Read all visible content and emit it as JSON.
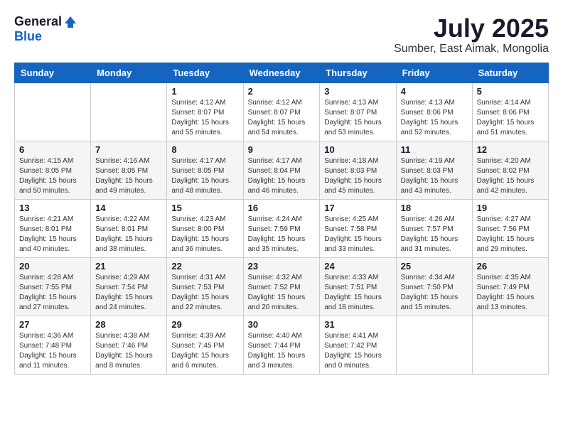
{
  "header": {
    "logo_general": "General",
    "logo_blue": "Blue",
    "month_title": "July 2025",
    "location": "Sumber, East Aimak, Mongolia"
  },
  "weekdays": [
    "Sunday",
    "Monday",
    "Tuesday",
    "Wednesday",
    "Thursday",
    "Friday",
    "Saturday"
  ],
  "weeks": [
    [
      {
        "day": "",
        "sunrise": "",
        "sunset": "",
        "daylight": ""
      },
      {
        "day": "",
        "sunrise": "",
        "sunset": "",
        "daylight": ""
      },
      {
        "day": "1",
        "sunrise": "Sunrise: 4:12 AM",
        "sunset": "Sunset: 8:07 PM",
        "daylight": "Daylight: 15 hours and 55 minutes."
      },
      {
        "day": "2",
        "sunrise": "Sunrise: 4:12 AM",
        "sunset": "Sunset: 8:07 PM",
        "daylight": "Daylight: 15 hours and 54 minutes."
      },
      {
        "day": "3",
        "sunrise": "Sunrise: 4:13 AM",
        "sunset": "Sunset: 8:07 PM",
        "daylight": "Daylight: 15 hours and 53 minutes."
      },
      {
        "day": "4",
        "sunrise": "Sunrise: 4:13 AM",
        "sunset": "Sunset: 8:06 PM",
        "daylight": "Daylight: 15 hours and 52 minutes."
      },
      {
        "day": "5",
        "sunrise": "Sunrise: 4:14 AM",
        "sunset": "Sunset: 8:06 PM",
        "daylight": "Daylight: 15 hours and 51 minutes."
      }
    ],
    [
      {
        "day": "6",
        "sunrise": "Sunrise: 4:15 AM",
        "sunset": "Sunset: 8:05 PM",
        "daylight": "Daylight: 15 hours and 50 minutes."
      },
      {
        "day": "7",
        "sunrise": "Sunrise: 4:16 AM",
        "sunset": "Sunset: 8:05 PM",
        "daylight": "Daylight: 15 hours and 49 minutes."
      },
      {
        "day": "8",
        "sunrise": "Sunrise: 4:17 AM",
        "sunset": "Sunset: 8:05 PM",
        "daylight": "Daylight: 15 hours and 48 minutes."
      },
      {
        "day": "9",
        "sunrise": "Sunrise: 4:17 AM",
        "sunset": "Sunset: 8:04 PM",
        "daylight": "Daylight: 15 hours and 46 minutes."
      },
      {
        "day": "10",
        "sunrise": "Sunrise: 4:18 AM",
        "sunset": "Sunset: 8:03 PM",
        "daylight": "Daylight: 15 hours and 45 minutes."
      },
      {
        "day": "11",
        "sunrise": "Sunrise: 4:19 AM",
        "sunset": "Sunset: 8:03 PM",
        "daylight": "Daylight: 15 hours and 43 minutes."
      },
      {
        "day": "12",
        "sunrise": "Sunrise: 4:20 AM",
        "sunset": "Sunset: 8:02 PM",
        "daylight": "Daylight: 15 hours and 42 minutes."
      }
    ],
    [
      {
        "day": "13",
        "sunrise": "Sunrise: 4:21 AM",
        "sunset": "Sunset: 8:01 PM",
        "daylight": "Daylight: 15 hours and 40 minutes."
      },
      {
        "day": "14",
        "sunrise": "Sunrise: 4:22 AM",
        "sunset": "Sunset: 8:01 PM",
        "daylight": "Daylight: 15 hours and 38 minutes."
      },
      {
        "day": "15",
        "sunrise": "Sunrise: 4:23 AM",
        "sunset": "Sunset: 8:00 PM",
        "daylight": "Daylight: 15 hours and 36 minutes."
      },
      {
        "day": "16",
        "sunrise": "Sunrise: 4:24 AM",
        "sunset": "Sunset: 7:59 PM",
        "daylight": "Daylight: 15 hours and 35 minutes."
      },
      {
        "day": "17",
        "sunrise": "Sunrise: 4:25 AM",
        "sunset": "Sunset: 7:58 PM",
        "daylight": "Daylight: 15 hours and 33 minutes."
      },
      {
        "day": "18",
        "sunrise": "Sunrise: 4:26 AM",
        "sunset": "Sunset: 7:57 PM",
        "daylight": "Daylight: 15 hours and 31 minutes."
      },
      {
        "day": "19",
        "sunrise": "Sunrise: 4:27 AM",
        "sunset": "Sunset: 7:56 PM",
        "daylight": "Daylight: 15 hours and 29 minutes."
      }
    ],
    [
      {
        "day": "20",
        "sunrise": "Sunrise: 4:28 AM",
        "sunset": "Sunset: 7:55 PM",
        "daylight": "Daylight: 15 hours and 27 minutes."
      },
      {
        "day": "21",
        "sunrise": "Sunrise: 4:29 AM",
        "sunset": "Sunset: 7:54 PM",
        "daylight": "Daylight: 15 hours and 24 minutes."
      },
      {
        "day": "22",
        "sunrise": "Sunrise: 4:31 AM",
        "sunset": "Sunset: 7:53 PM",
        "daylight": "Daylight: 15 hours and 22 minutes."
      },
      {
        "day": "23",
        "sunrise": "Sunrise: 4:32 AM",
        "sunset": "Sunset: 7:52 PM",
        "daylight": "Daylight: 15 hours and 20 minutes."
      },
      {
        "day": "24",
        "sunrise": "Sunrise: 4:33 AM",
        "sunset": "Sunset: 7:51 PM",
        "daylight": "Daylight: 15 hours and 18 minutes."
      },
      {
        "day": "25",
        "sunrise": "Sunrise: 4:34 AM",
        "sunset": "Sunset: 7:50 PM",
        "daylight": "Daylight: 15 hours and 15 minutes."
      },
      {
        "day": "26",
        "sunrise": "Sunrise: 4:35 AM",
        "sunset": "Sunset: 7:49 PM",
        "daylight": "Daylight: 15 hours and 13 minutes."
      }
    ],
    [
      {
        "day": "27",
        "sunrise": "Sunrise: 4:36 AM",
        "sunset": "Sunset: 7:48 PM",
        "daylight": "Daylight: 15 hours and 11 minutes."
      },
      {
        "day": "28",
        "sunrise": "Sunrise: 4:38 AM",
        "sunset": "Sunset: 7:46 PM",
        "daylight": "Daylight: 15 hours and 8 minutes."
      },
      {
        "day": "29",
        "sunrise": "Sunrise: 4:39 AM",
        "sunset": "Sunset: 7:45 PM",
        "daylight": "Daylight: 15 hours and 6 minutes."
      },
      {
        "day": "30",
        "sunrise": "Sunrise: 4:40 AM",
        "sunset": "Sunset: 7:44 PM",
        "daylight": "Daylight: 15 hours and 3 minutes."
      },
      {
        "day": "31",
        "sunrise": "Sunrise: 4:41 AM",
        "sunset": "Sunset: 7:42 PM",
        "daylight": "Daylight: 15 hours and 0 minutes."
      },
      {
        "day": "",
        "sunrise": "",
        "sunset": "",
        "daylight": ""
      },
      {
        "day": "",
        "sunrise": "",
        "sunset": "",
        "daylight": ""
      }
    ]
  ]
}
